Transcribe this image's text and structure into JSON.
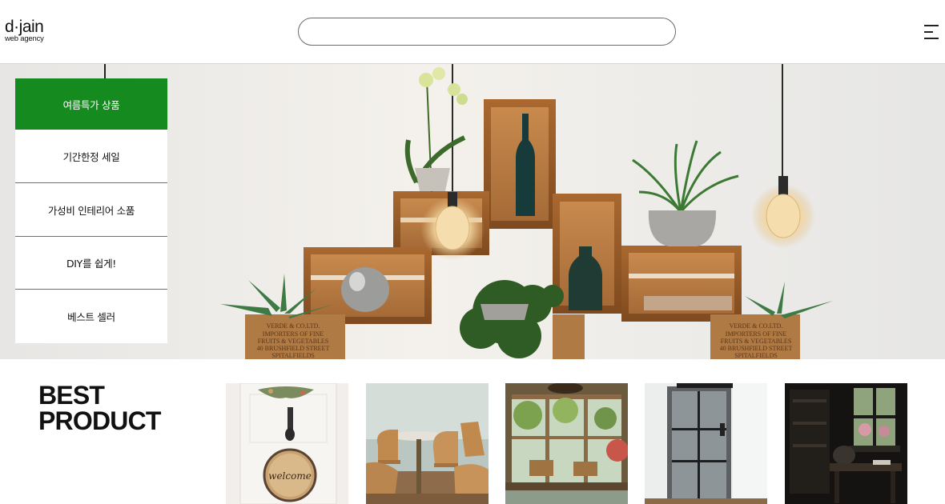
{
  "header": {
    "logo_main": "d·jain",
    "logo_sub": "web agency",
    "search_value": "",
    "menu_icon": "hamburger-menu-icon"
  },
  "side_menu": {
    "items": [
      {
        "label": "여름특가 상품",
        "active": true
      },
      {
        "label": "기간한정 세일",
        "active": false
      },
      {
        "label": "가성비 인테리어 소품",
        "active": false
      },
      {
        "label": "DIY를 쉽게!",
        "active": false
      },
      {
        "label": "베스트 셀러",
        "active": false
      }
    ]
  },
  "hero": {
    "crate_label_lines": [
      "VERDE & CO.LTD.",
      "IMPORTERS OF FINE",
      "FRUITS & VEGETABLES",
      "40 BRUSHFIELD STREET",
      "SPITALFIELDS",
      "LONDON E.1"
    ]
  },
  "best_product": {
    "title_line1": "BEST",
    "title_line2": "PRODUCT",
    "items": [
      {
        "label": "welcome"
      },
      {
        "label": ""
      },
      {
        "label": ""
      },
      {
        "label": ""
      },
      {
        "label": ""
      }
    ]
  },
  "colors": {
    "accent_green": "#158a1f",
    "divider": "#d6d6d6"
  }
}
